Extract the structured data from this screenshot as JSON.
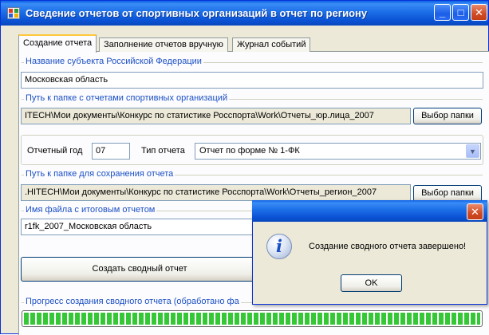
{
  "window": {
    "title": "Сведение отчетов от спортивных организаций в отчет по региону",
    "minimize": "_",
    "maximize": "□",
    "close": "✕"
  },
  "tabs": [
    {
      "label": "Создание отчета",
      "active": true
    },
    {
      "label": "Заполнение отчетов вручную",
      "active": false
    },
    {
      "label": "Журнал событий",
      "active": false
    }
  ],
  "subject": {
    "group_label": "Название субъекта Российской Федерации",
    "value": "Московская область"
  },
  "source_folder": {
    "group_label": "Путь к папке с отчетами спортивных организаций",
    "value": "ITECH\\Мои документы\\Конкурс по статистике Росспорта\\Work\\Отчеты_юр.лица_2007",
    "button": "Выбор папки"
  },
  "report_params": {
    "year_label": "Отчетный год",
    "year_value": "07",
    "type_label": "Тип отчета",
    "type_value": "Отчет по форме № 1-ФК"
  },
  "save_folder": {
    "group_label": "Путь к папке для сохранения отчета",
    "value": ".HITECH\\Мои документы\\Конкурс по статистике Росспорта\\Work\\Отчеты_регион_2007",
    "button": "Выбор папки"
  },
  "result_file": {
    "group_label": "Имя файла с итоговым отчетом",
    "value": "r1fk_2007_Московская область"
  },
  "create_button": "Создать сводный отчет",
  "progress": {
    "label": "Прогресс создания сводного отчета (обработано фа",
    "value": 1.0,
    "fill_color": "#35c736"
  },
  "dialog": {
    "close": "✕",
    "icon": "info-icon",
    "message": "Создание сводного отчета завершено!",
    "ok": "OK"
  },
  "colors": {
    "titlebar": "#0a52d4",
    "group_label": "#1a4fc4",
    "face": "#ece9d8"
  }
}
